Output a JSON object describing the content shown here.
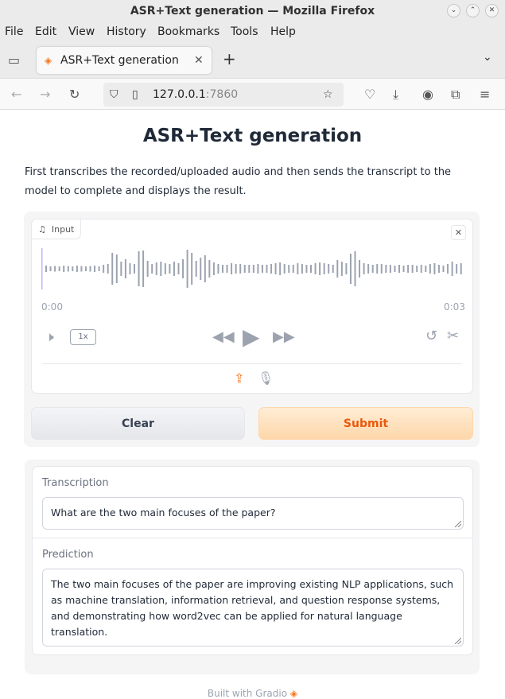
{
  "window": {
    "title": "ASR+Text generation — Mozilla Firefox"
  },
  "menu": [
    "File",
    "Edit",
    "View",
    "History",
    "Bookmarks",
    "Tools",
    "Help"
  ],
  "tab": {
    "title": "ASR+Text generation"
  },
  "url": {
    "host": "127.0.0.1",
    "port": ":7860"
  },
  "page": {
    "title": "ASR+Text generation",
    "description": "First transcribes the recorded/uploaded audio and then sends the transcript to the model to complete and displays the result."
  },
  "audio": {
    "label": "Input",
    "time_start": "0:00",
    "time_end": "0:03",
    "speed": "1x"
  },
  "buttons": {
    "clear": "Clear",
    "submit": "Submit"
  },
  "transcription": {
    "label": "Transcription",
    "value": "What are the two main focuses of the paper?"
  },
  "prediction": {
    "label": "Prediction",
    "value": "The two main focuses of the paper are improving existing NLP applications, such as machine translation, information retrieval, and question response systems, and demonstrating how word2vec can be applied for natural language translation."
  },
  "footer": "Built with Gradio",
  "colors": {
    "accent": "#f97316",
    "submit_bg": "#fed7aa",
    "waveform": "#9ca3af"
  }
}
